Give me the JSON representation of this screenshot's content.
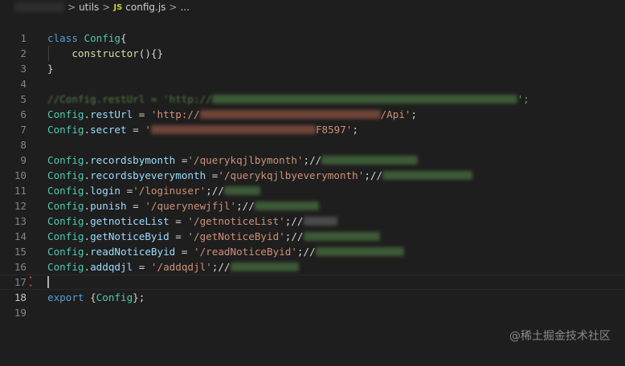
{
  "breadcrumb": {
    "items": [
      "utils",
      "config.js",
      "..."
    ],
    "separator": ">",
    "file_icon": "JS"
  },
  "line_numbers": [
    "1",
    "2",
    "3",
    "4",
    "5",
    "6",
    "7",
    "8",
    "9",
    "10",
    "11",
    "12",
    "13",
    "14",
    "15",
    "16",
    "17",
    "18",
    "19"
  ],
  "code": {
    "l2_kw": "class",
    "l2_cls": "Config",
    "l2_brace": "{",
    "l3_fn": "constructor",
    "l3_rest": "(){}",
    "l4": "}",
    "l6_cm_start": "//Config.restUrl = 'http://",
    "l6_cm_end": "';",
    "l7_obj": "Config",
    "l7_dot": ".",
    "l7_prop": "restUrl",
    "l7_eq": " = ",
    "l7_str_start": "'http://",
    "l7_str_mid": "/Api'",
    "l7_end": ";",
    "l8_obj": "Config",
    "l8_prop": "secret",
    "l8_eq": " = ",
    "l8_str_start": "'",
    "l8_str_end": "F8597'",
    "l8_end": ";",
    "l10_prop": "recordsbymonth",
    "l10_eq": " =",
    "l10_str": "'/querykqjlbymonth'",
    "l10_end": ";//",
    "l11_prop": "recordsbyeverymonth",
    "l11_eq": " =",
    "l11_str": "'/querykqjlbyeverymonth'",
    "l11_end": ";//",
    "l12_prop": "login",
    "l12_eq": " =",
    "l12_str": "'/loginuser'",
    "l12_end": ";//",
    "l13_prop": "punish",
    "l13_eq": " = ",
    "l13_str": "'/querynewjfjl'",
    "l13_end": ";//",
    "l14_prop": "getnoticeList",
    "l14_eq": " = ",
    "l14_str": "'/getnoticeList'",
    "l14_end": ";//",
    "l15_prop": "getNoticeByid",
    "l15_eq": " = ",
    "l15_str": "'/getNoticeByid'",
    "l15_end": ";//",
    "l16_prop": "readNoticeByid",
    "l16_eq": " = ",
    "l16_str": "'/readNoticeByid'",
    "l16_end": ";//",
    "l17_prop": "addqdjl",
    "l17_eq": " = ",
    "l17_str": "'/addqdjl'",
    "l17_end": ";//",
    "l19_kw": "export",
    "l19_open": " {",
    "l19_cls": "Config",
    "l19_close": "};"
  },
  "watermark": "@稀土掘金技术社区",
  "colors": {
    "background": "#1e1e1e",
    "keyword": "#569cd6",
    "class": "#4ec9b0",
    "function": "#dcdcaa",
    "property": "#9cdcfe",
    "string": "#ce9178",
    "comment": "#6a9955",
    "line_number": "#858585"
  }
}
